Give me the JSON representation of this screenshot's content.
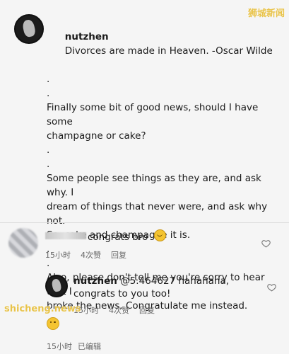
{
  "watermarks": {
    "top": "狮城新闻",
    "bottom": "shicheng.news"
  },
  "post": {
    "username": "nutzhen",
    "lines": [
      "Divorces are made in Heaven. -Oscar Wilde",
      ".",
      ".",
      "Finally some bit of good news, should I have some",
      "champagne or cake?",
      ".",
      ".",
      "Some people see things as they are, and ask why. I",
      "dream of things that never were, and ask why not.",
      "So, cake and champagne it is.",
      ".",
      ".",
      "Also, please don't tell me you're sorry to hear that I",
      "broke the news. Congratulate me instead."
    ],
    "time": "15小时",
    "edited": "已编辑"
  },
  "comment": {
    "text": "congrats bro",
    "time": "15小时",
    "likes": "4次赞",
    "reply": "回复"
  },
  "reply": {
    "username": "nutzhen",
    "mention": "@5.464627",
    "text": "hahahaha, congrats to you too!",
    "time": "15小时",
    "likes": "4次赞",
    "reply": "回复"
  }
}
